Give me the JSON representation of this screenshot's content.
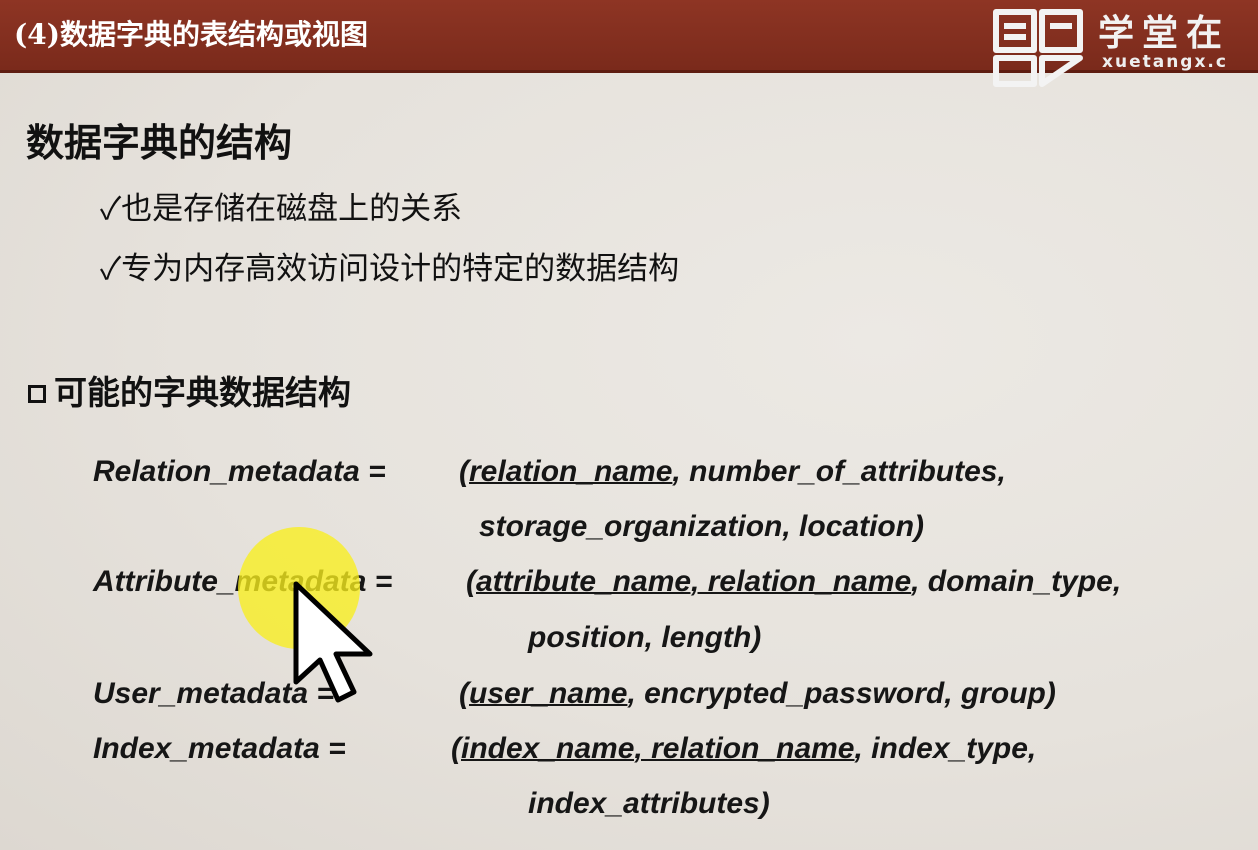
{
  "header": {
    "title": "(4)数据字典的表结构或视图",
    "logo_text": "学堂在",
    "logo_sub": "xuetangx.c"
  },
  "main": {
    "heading": "数据字典的结构",
    "bullets": [
      "✓也是存储在磁盘上的关系",
      "✓专为内存高效访问设计的特定的数据结构"
    ],
    "subheading": "可能的字典数据结构",
    "relation": {
      "name": "Relation_metadata =",
      "key": "relation_name",
      "rest1": ", number_of_attributes,",
      "line2": "storage_organization, location)"
    },
    "attribute": {
      "name": "Attribute_metadata =",
      "key": "attribute_name, relation_name",
      "rest1": ", domain_type,",
      "line2": "position, length)"
    },
    "user": {
      "name": "User_metadata =",
      "key": "user_name",
      "rest1": ", encrypted_password, group)"
    },
    "index": {
      "name": "Index_metadata =",
      "key": "index_name, relation_name",
      "rest1": ", index_type,",
      "line2": "index_attributes)"
    }
  },
  "colors": {
    "title_bar": "#8e3524",
    "highlight": "#f8ee1e"
  },
  "icons": [
    "xuetangx-logo-icon",
    "mouse-cursor-icon"
  ]
}
